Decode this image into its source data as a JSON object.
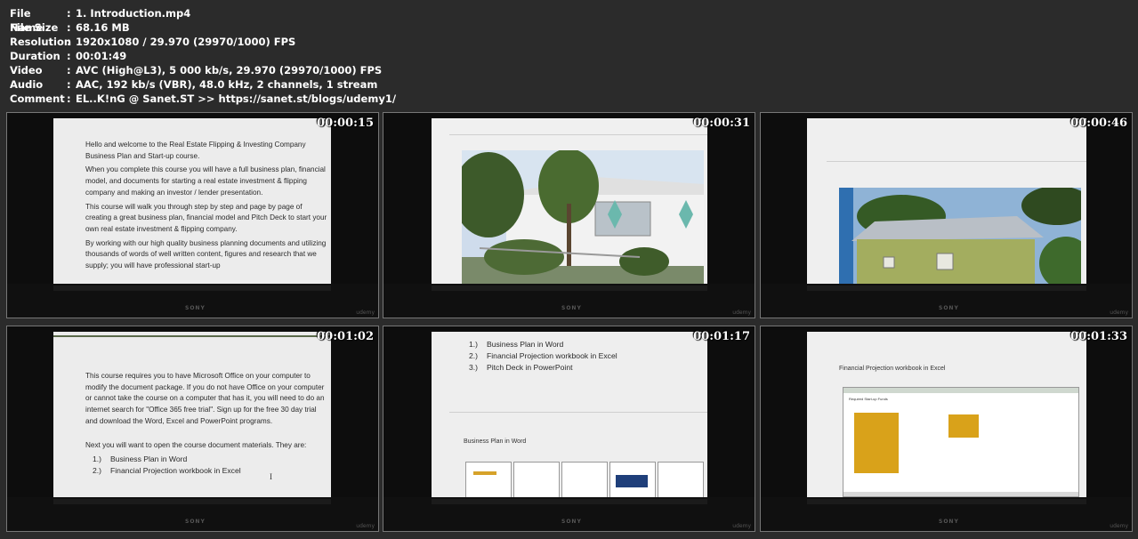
{
  "info": [
    {
      "key": "File Name",
      "value": "1. Introduction.mp4"
    },
    {
      "key": "File Size",
      "value": "68.16 MB"
    },
    {
      "key": "Resolution",
      "value": "1920x1080 / 29.970 (29970/1000) FPS"
    },
    {
      "key": "Duration",
      "value": "00:01:49"
    },
    {
      "key": "Video",
      "value": "AVC (High@L3), 5 000 kb/s, 29.970 (29970/1000) FPS"
    },
    {
      "key": "Audio",
      "value": "AAC, 192 kb/s (VBR), 48.0 kHz, 2 channels, 1 stream"
    },
    {
      "key": "Comment",
      "value": "EL..K!nG @ Sanet.ST  >> https://sanet.st/blogs/udemy1/"
    }
  ],
  "separator": ":",
  "brand": "SONY",
  "watermark": "udemy",
  "thumbs": [
    {
      "timestamp": "00:00:15"
    },
    {
      "timestamp": "00:00:31"
    },
    {
      "timestamp": "00:00:46"
    },
    {
      "timestamp": "00:01:02"
    },
    {
      "timestamp": "00:01:17"
    },
    {
      "timestamp": "00:01:33"
    }
  ],
  "frame1": {
    "paragraphs": [
      "Hello and welcome to the Real Estate Flipping & Investing Company Business Plan and Start-up course.",
      "When you complete this course you will have a full business plan, financial model, and documents for starting a real estate investment & flipping company and making an investor / lender presentation.",
      "This course will walk you through step by step and page by page of creating a great business plan, financial model and Pitch Deck to start your own real estate investment & flipping company.",
      "By working with our high quality business planning documents and utilizing thousands of words of well written content, figures and research that we supply; you will have professional start-up"
    ]
  },
  "frame4": {
    "paragraphs": [
      "This course requires you to have Microsoft Office on your computer to modify the document package. If you do not have Office on your computer or cannot take the course on a computer that has it, you will need to do an internet search for \"Office 365 free trial\". Sign up for the free 30 day trial and download the Word, Excel and PowerPoint programs.",
      "Next you will want to open the course document materials. They are:"
    ],
    "list": [
      {
        "num": "1.)",
        "text": "Business Plan in Word"
      },
      {
        "num": "2.)",
        "text": "Financial Projection workbook in Excel"
      }
    ],
    "cursor": "I"
  },
  "frame5": {
    "list": [
      {
        "num": "1.)",
        "text": "Business Plan in Word"
      },
      {
        "num": "2.)",
        "text": "Financial Projection workbook in Excel"
      },
      {
        "num": "3.)",
        "text": "Pitch Deck in PowerPoint"
      }
    ],
    "section_title": "Business Plan in Word"
  },
  "frame6": {
    "section_title": "Financial Projection workbook in Excel",
    "sheet_title": "Required Start-up Funds"
  }
}
